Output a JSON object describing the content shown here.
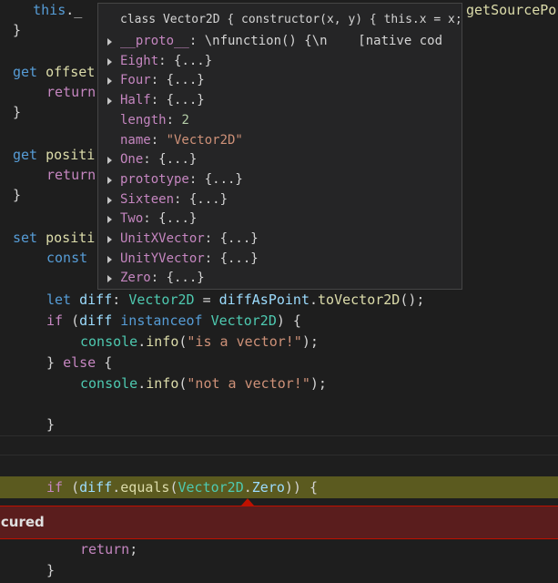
{
  "code": {
    "line1": {
      "indent": "    ",
      "this": "this",
      "after": "._",
      "tail": "getSourcePo"
    },
    "line2": {
      "text": "}"
    },
    "line3": {
      "get": "get",
      "name": "offset"
    },
    "line4": {
      "kw": "return"
    },
    "line5": {
      "text": "}"
    },
    "line6": {
      "get": "get",
      "name": "positi"
    },
    "line7": {
      "kw": "return"
    },
    "line8": {
      "text": "}"
    },
    "line9": {
      "set": "set",
      "name": "positi"
    },
    "line10": {
      "kw": "const"
    },
    "line11": {
      "let": "let",
      "var": "diff",
      "colon": ":",
      "type": "Vector2D",
      "eq": " = ",
      "rhs": "diffAsPoint",
      "dot": ".",
      "method": "toVector2D",
      "end": "();"
    },
    "line12": {
      "if": "if",
      "p1": " (",
      "var": "diff",
      "op": "instanceof",
      "type": "Vector2D",
      "p2": ") {"
    },
    "line13": {
      "obj": "console",
      "dot": ".",
      "fn": "info",
      "p1": "(",
      "str": "\"is a vector!\"",
      "p2": ");"
    },
    "line14": {
      "b1": "} ",
      "else": "else",
      "b2": " {"
    },
    "line15": {
      "obj": "console",
      "dot": ".",
      "fn": "info",
      "p1": "(",
      "str": "\"not a vector!\"",
      "p2": ");"
    },
    "line16": {
      "text": "}"
    },
    "line17": {
      "if": "if",
      "p1": " (",
      "var": "diff",
      "dot": ".",
      "fn": "equals",
      "p2": "(",
      "type": "Vector2D",
      "dot2": ".",
      "prop": "Zero",
      "p3": ")) {"
    },
    "line18": {
      "kw": "return",
      "end": ";"
    },
    "line19": {
      "text": "}"
    }
  },
  "error": {
    "text": "ccured"
  },
  "hover": {
    "title": "class Vector2D { constructor(x, y) { this.x = x;",
    "items": [
      {
        "expandable": true,
        "name": "__proto__",
        "sep": ": ",
        "value": "\\nfunction() {\\n",
        "extra": "    [native cod"
      },
      {
        "expandable": true,
        "name": "Eight",
        "sep": ": ",
        "value": "{...}"
      },
      {
        "expandable": true,
        "name": "Four",
        "sep": ": ",
        "value": "{...}"
      },
      {
        "expandable": true,
        "name": "Half",
        "sep": ": ",
        "value": "{...}"
      },
      {
        "expandable": false,
        "name": "length",
        "sep": ": ",
        "value": "2"
      },
      {
        "expandable": false,
        "name": "name",
        "sep": ": ",
        "value": "\"Vector2D\""
      },
      {
        "expandable": true,
        "name": "One",
        "sep": ": ",
        "value": "{...}"
      },
      {
        "expandable": true,
        "name": "prototype",
        "sep": ": ",
        "value": "{...}"
      },
      {
        "expandable": true,
        "name": "Sixteen",
        "sep": ": ",
        "value": "{...}"
      },
      {
        "expandable": true,
        "name": "Two",
        "sep": ": ",
        "value": "{...}"
      },
      {
        "expandable": true,
        "name": "UnitXVector",
        "sep": ": ",
        "value": "{...}"
      },
      {
        "expandable": true,
        "name": "UnitYVector",
        "sep": ": ",
        "value": "{...}"
      },
      {
        "expandable": true,
        "name": "Zero",
        "sep": ": ",
        "value": "{...}"
      }
    ]
  }
}
